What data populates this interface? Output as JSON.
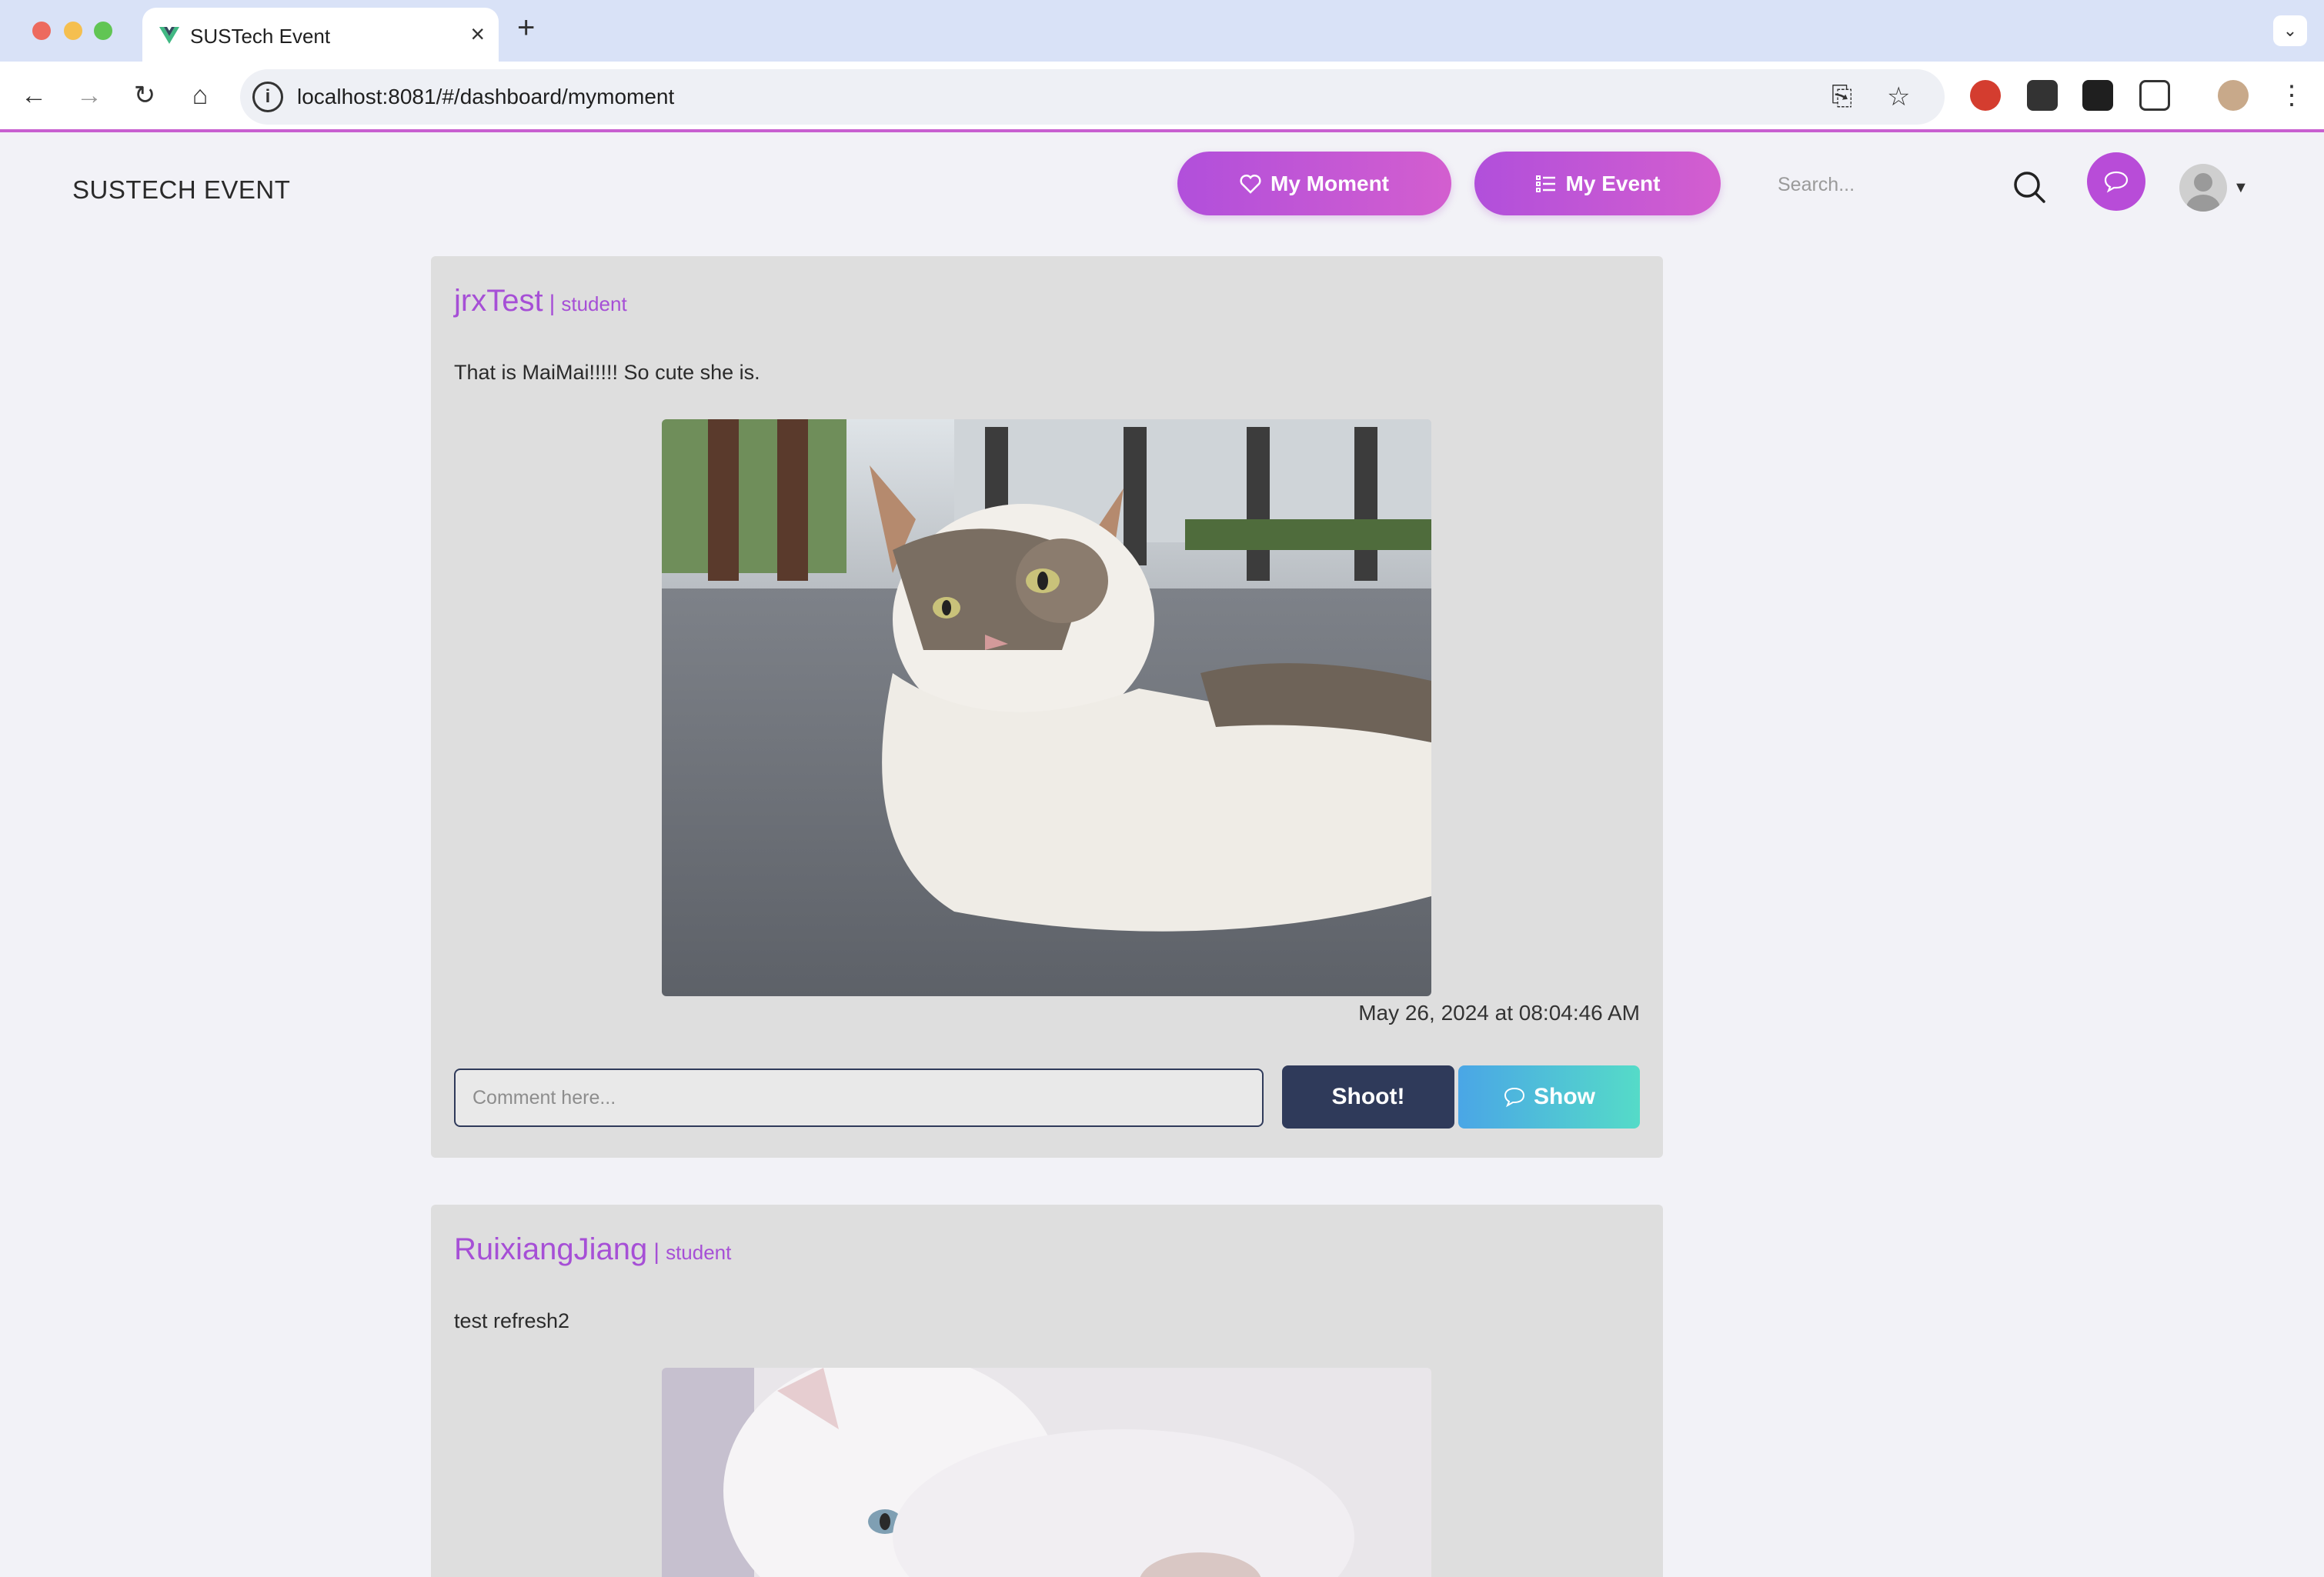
{
  "browser": {
    "tab_title": "SUSTech Event",
    "url": "localhost:8081/#/dashboard/mymoment"
  },
  "header": {
    "brand": "SUSTECH EVENT",
    "my_moment_label": "My Moment",
    "my_event_label": "My Event",
    "search_placeholder": "Search..."
  },
  "moments": [
    {
      "author": "jrxTest",
      "separator": "|",
      "role": "student",
      "text": "That is MaiMai!!!!! So cute she is.",
      "timestamp": "May 26, 2024 at 08:04:46 AM",
      "comment_placeholder": "Comment here...",
      "shoot_label": "Shoot!",
      "show_label": "Show"
    },
    {
      "author": "RuixiangJiang",
      "separator": "|",
      "role": "student",
      "text": "test refresh2"
    }
  ],
  "colors": {
    "accent": "#b14fdb",
    "author": "#a64fd6",
    "dark_button": "#2f3a5a",
    "card_bg": "#dedede"
  }
}
